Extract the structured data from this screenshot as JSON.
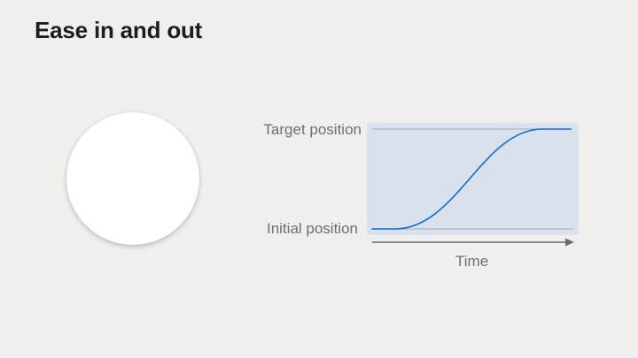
{
  "slide": {
    "title": "Ease in and out"
  },
  "diagram": {
    "target_label": "Target position",
    "initial_label": "Initial position",
    "time_label": "Time",
    "curve": "ease-in-out",
    "colors": {
      "plot_background": "#d9e1ed",
      "curve": "#0f6ad8",
      "guide_line": "#a2acbb",
      "axis": "#6a6a6a",
      "ball": "#ffffff"
    }
  }
}
